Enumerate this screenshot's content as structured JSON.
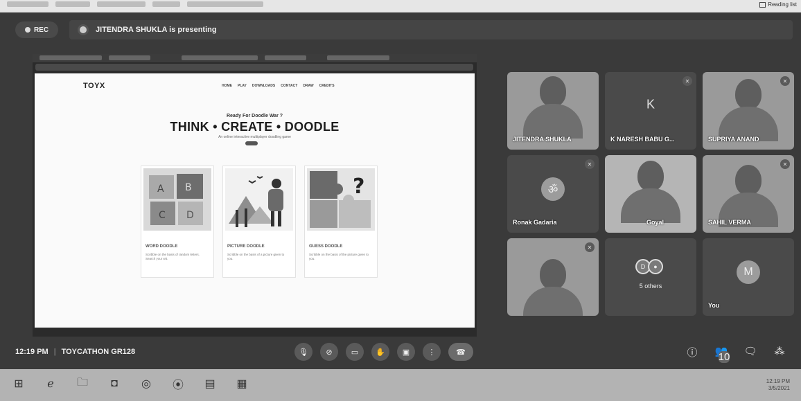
{
  "browser": {
    "reading_list_label": "Reading list"
  },
  "meet": {
    "rec_label": "REC",
    "presenter_text": "JITENDRA SHUKLA is presenting",
    "time": "12:19 PM",
    "separator": "|",
    "meeting_name": "TOYCATHON GR128",
    "participant_badge": "10"
  },
  "site": {
    "logo": "TOYX",
    "nav": [
      "HOME",
      "PLAY",
      "DOWNLOADS",
      "CONTACT",
      "DRAW",
      "CREDITS"
    ],
    "tagline": "Ready For Doodle War ?",
    "headline": "THINK • CREATE • DOODLE",
    "subtext": "An online interactive multiplayer doodling game",
    "cards": [
      {
        "title": "WORD DOODLE",
        "desc": "Scribble on the basis of random letters. Search your wit."
      },
      {
        "title": "PICTURE DOODLE",
        "desc": "Scribble on the basis of a picture given to you."
      },
      {
        "title": "GUESS DOODLE",
        "desc": "Scribble on the basis of the picture given to you."
      }
    ]
  },
  "participants": [
    {
      "name": "JITENDRA SHUKLA"
    },
    {
      "name": "K NARESH BABU G...",
      "initial": "K"
    },
    {
      "name": "SUPRIYA ANAND"
    },
    {
      "name": "Ronak Gadaria"
    },
    {
      "name": "Goyal"
    },
    {
      "name": "SAHIL VERMA"
    },
    {
      "name": ""
    },
    {
      "name": "5 others",
      "avatars": [
        "D",
        "●"
      ]
    },
    {
      "name": "You",
      "initial": "M"
    }
  ],
  "taskbar": {
    "time": "12:19 PM",
    "date": "3/5/2021"
  }
}
